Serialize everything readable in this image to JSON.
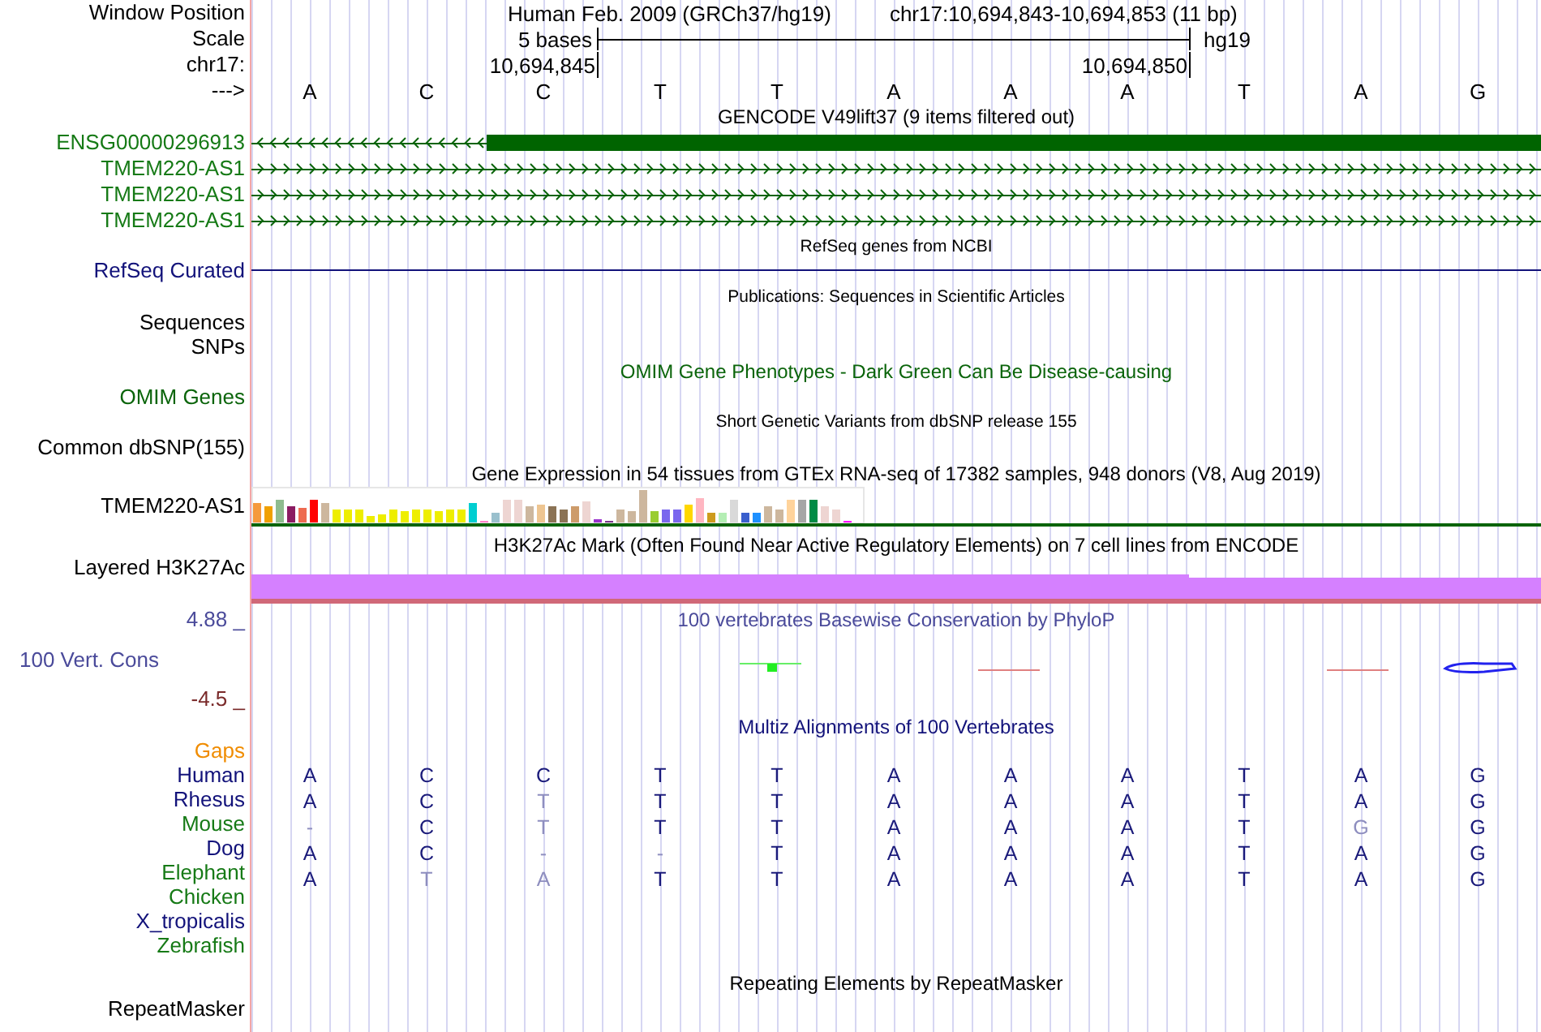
{
  "header": {
    "label": "Window Position",
    "assembly": "Human Feb. 2009 (GRCh37/hg19)",
    "position": "chr17:10,694,843-10,694,853 (11 bp)"
  },
  "scale": {
    "label": "Scale",
    "span": "5 bases",
    "db": "hg19"
  },
  "ruler": {
    "label": "chr17:",
    "ticks": [
      "10,694,845",
      "10,694,850"
    ]
  },
  "bases": {
    "label": "--->",
    "values": [
      "A",
      "C",
      "C",
      "T",
      "T",
      "A",
      "A",
      "A",
      "T",
      "A",
      "G"
    ]
  },
  "tracks": [
    {
      "kind": "genes",
      "title": "GENCODE V49lift37 (9 items filtered out)",
      "items": [
        {
          "name": "ENSG00000296913",
          "reverse": true,
          "exon": true,
          "color": "#167a16"
        },
        {
          "name": "TMEM220-AS1",
          "reverse": false,
          "exon": false,
          "color": "#167a16"
        },
        {
          "name": "TMEM220-AS1",
          "reverse": false,
          "exon": false,
          "color": "#167a16"
        },
        {
          "name": "TMEM220-AS1",
          "reverse": false,
          "exon": false,
          "color": "#167a16"
        }
      ]
    },
    {
      "kind": "line",
      "title": "RefSeq genes from NCBI",
      "label": "RefSeq Curated",
      "color": "#12127a"
    },
    {
      "kind": "empty",
      "title": "Publications: Sequences in Scientific Articles",
      "labels": [
        "Sequences",
        "SNPs"
      ]
    },
    {
      "kind": "empty",
      "title": "OMIM Gene Phenotypes - Dark Green Can Be Disease-causing",
      "labels": [
        "OMIM Genes"
      ],
      "color": "#0a640a"
    },
    {
      "kind": "empty",
      "title": "Short Genetic Variants from dbSNP release 155",
      "labels": [
        "Common dbSNP(155)"
      ]
    },
    {
      "kind": "bars",
      "title": "Gene Expression in 54 tissues from GTEx RNA-seq of 17382 samples, 948 donors (V8, Aug 2019)",
      "label": "TMEM220-AS1"
    },
    {
      "kind": "layered",
      "title": "H3K27Ac Mark (Often Found Near Active Regulatory Elements) on 7 cell lines from ENCODE",
      "label": "Layered H3K27Ac"
    },
    {
      "kind": "wiggle",
      "title": "100 vertebrates Basewise Conservation by PhyloP",
      "label": "100 Vert. Cons",
      "max": "4.88 _",
      "min": "-4.5 _",
      "color": "#4a4a9a"
    },
    {
      "kind": "alignment",
      "title": "Multiz Alignments of 100 Vertebrates",
      "color": "#12127a",
      "gaps": {
        "label": "Gaps",
        "color": "#f08c00"
      },
      "species": [
        {
          "name": "Human",
          "color": "#12127a",
          "bases": [
            {
              "b": "A",
              "differs": false
            },
            {
              "b": "C",
              "differs": false
            },
            {
              "b": "C",
              "differs": false
            },
            {
              "b": "T",
              "differs": false
            },
            {
              "b": "T",
              "differs": false
            },
            {
              "b": "A",
              "differs": false
            },
            {
              "b": "A",
              "differs": false
            },
            {
              "b": "A",
              "differs": false
            },
            {
              "b": "T",
              "differs": false
            },
            {
              "b": "A",
              "differs": false
            },
            {
              "b": "G",
              "differs": false
            }
          ]
        },
        {
          "name": "Rhesus",
          "color": "#12127a",
          "bases": [
            {
              "b": "A",
              "differs": false
            },
            {
              "b": "C",
              "differs": false
            },
            {
              "b": "T",
              "differs": true
            },
            {
              "b": "T",
              "differs": false
            },
            {
              "b": "T",
              "differs": false
            },
            {
              "b": "A",
              "differs": false
            },
            {
              "b": "A",
              "differs": false
            },
            {
              "b": "A",
              "differs": false
            },
            {
              "b": "T",
              "differs": false
            },
            {
              "b": "A",
              "differs": false
            },
            {
              "b": "G",
              "differs": false
            }
          ]
        },
        {
          "name": "Mouse",
          "color": "#167a16",
          "bases": [
            {
              "b": "-",
              "differs": true
            },
            {
              "b": "C",
              "differs": false
            },
            {
              "b": "T",
              "differs": true
            },
            {
              "b": "T",
              "differs": false
            },
            {
              "b": "T",
              "differs": false
            },
            {
              "b": "A",
              "differs": false
            },
            {
              "b": "A",
              "differs": false
            },
            {
              "b": "A",
              "differs": false
            },
            {
              "b": "T",
              "differs": false
            },
            {
              "b": "G",
              "differs": true
            },
            {
              "b": "G",
              "differs": false
            }
          ]
        },
        {
          "name": "Dog",
          "color": "#12127a",
          "bases": [
            {
              "b": "A",
              "differs": false
            },
            {
              "b": "C",
              "differs": false
            },
            {
              "b": "-",
              "differs": true
            },
            {
              "b": "-",
              "differs": true
            },
            {
              "b": "T",
              "differs": false
            },
            {
              "b": "A",
              "differs": false
            },
            {
              "b": "A",
              "differs": false
            },
            {
              "b": "A",
              "differs": false
            },
            {
              "b": "T",
              "differs": false
            },
            {
              "b": "A",
              "differs": false
            },
            {
              "b": "G",
              "differs": false
            }
          ]
        },
        {
          "name": "Elephant",
          "color": "#167a16",
          "bases": [
            {
              "b": "A",
              "differs": false
            },
            {
              "b": "T",
              "differs": true
            },
            {
              "b": "A",
              "differs": true
            },
            {
              "b": "T",
              "differs": false
            },
            {
              "b": "T",
              "differs": false
            },
            {
              "b": "A",
              "differs": false
            },
            {
              "b": "A",
              "differs": false
            },
            {
              "b": "A",
              "differs": false
            },
            {
              "b": "T",
              "differs": false
            },
            {
              "b": "A",
              "differs": false
            },
            {
              "b": "G",
              "differs": false
            }
          ]
        },
        {
          "name": "Chicken",
          "color": "#167a16"
        },
        {
          "name": "X_tropicalis",
          "color": "#12127a"
        },
        {
          "name": "Zebrafish",
          "color": "#167a16"
        }
      ]
    },
    {
      "kind": "empty",
      "title": "Repeating Elements by RepeatMasker",
      "labels": [
        "RepeatMasker"
      ]
    }
  ]
}
